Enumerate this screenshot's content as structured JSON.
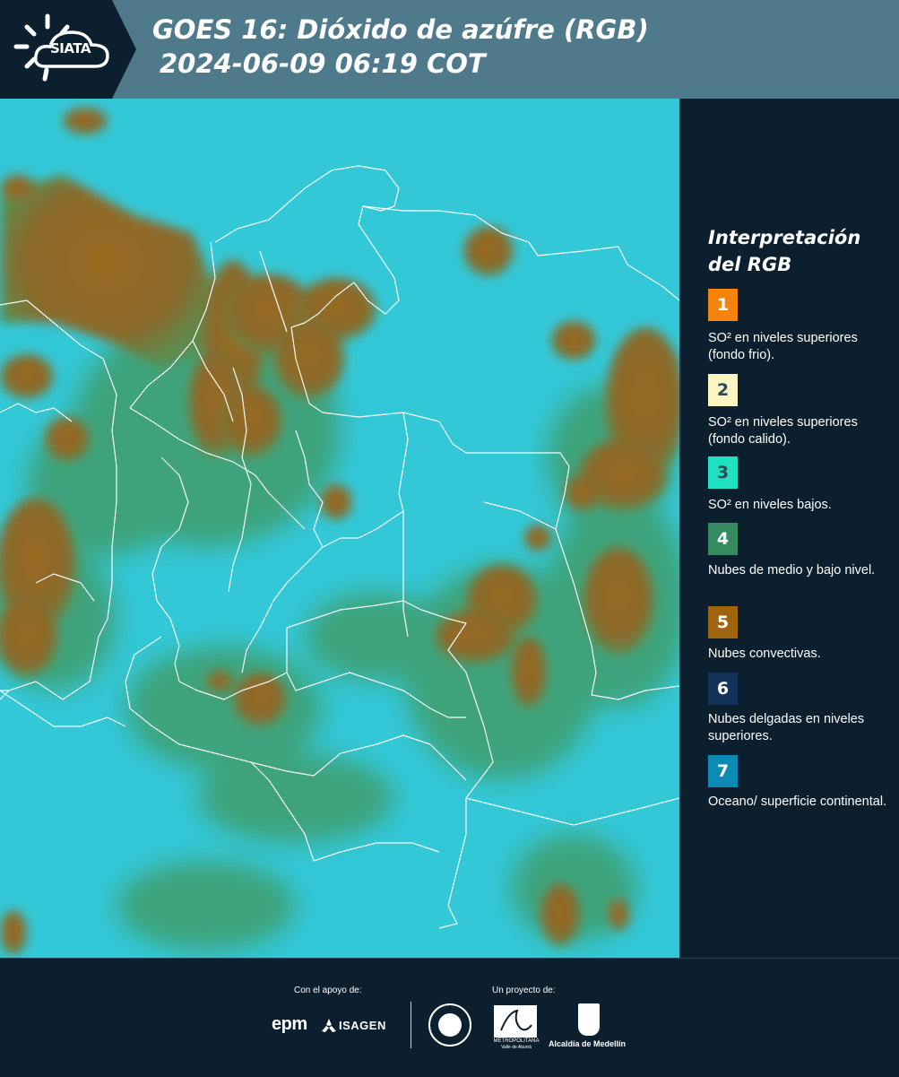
{
  "header": {
    "logo_text": "SIATA",
    "title_line1": "GOES 16: Dióxido de azúfre (RGB)",
    "title_line2": "2024-06-09 06:19 COT"
  },
  "legend": {
    "title_line1": "Interpretación",
    "title_line2": "del RGB",
    "items": [
      {
        "number": "1",
        "label": "SO² en niveles superiores (fondo frio).",
        "color": "#f5840f"
      },
      {
        "number": "2",
        "label": "SO² en niveles superiores (fondo calido).",
        "color": "#fbf6c2"
      },
      {
        "number": "3",
        "label": "SO² en niveles bajos.",
        "color": "#1de1c1"
      },
      {
        "number": "4",
        "label": "Nubes de medio y bajo nivel.",
        "color": "#358a60"
      },
      {
        "number": "5",
        "label": "Nubes convectivas.",
        "color": "#a0640f"
      },
      {
        "number": "6",
        "label": "Nubes delgadas en niveles superiores.",
        "color": "#13335a"
      },
      {
        "number": "7",
        "label": "Oceano/ superficie continental.",
        "color": "#0d8ab3"
      }
    ]
  },
  "footer": {
    "support_label": "Con el apoyo de:",
    "project_label": "Un proyecto de:",
    "sponsors": [
      "epm",
      "ISAGEN"
    ],
    "partners": [
      "METROPOLITANA",
      "Valle de Aburrá",
      "Alcaldía de Medellín"
    ]
  },
  "colors": {
    "background": "#0b1f2e",
    "header_band": "#4e7a8c",
    "map_base": "#2fc9d9",
    "cloud_convective": "#8a6a2a",
    "cloud_mid": "#4fa070",
    "borders": "#ffffff"
  },
  "icons": [
    "sun-icon",
    "cloud-icon"
  ]
}
